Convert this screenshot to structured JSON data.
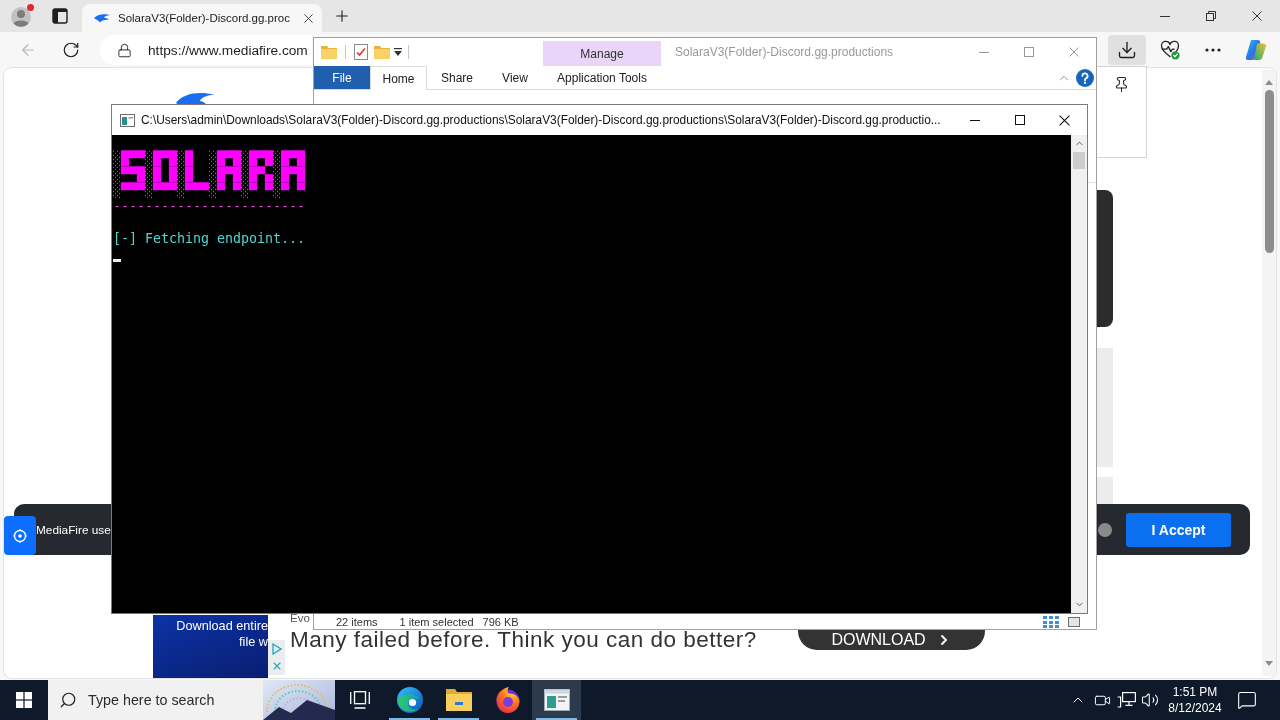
{
  "browser": {
    "tabs": [
      {
        "title": "SolaraV3(Folder)-Discord.gg.proc",
        "selected": true
      }
    ],
    "back_button": {
      "disabled": true
    },
    "address_bar": {
      "url": "https://www.mediafire.com"
    },
    "toolbar": [
      {
        "kind": "downloads",
        "selected": true
      },
      {
        "kind": "health",
        "selected": false
      },
      {
        "kind": "more",
        "selected": false
      },
      {
        "kind": "assistant",
        "selected": false
      }
    ]
  },
  "page": {
    "cookie_banner": {
      "text": "MediaFire use",
      "button": "I Accept"
    },
    "ad": {
      "image_lines": [
        "Download entire",
        "file w"
      ],
      "brand": "Evo",
      "headline": "Many failed before. Think you can do better?",
      "button": "DOWNLOAD"
    }
  },
  "explorer": {
    "title": "SolaraV3(Folder)-Discord.gg.productions",
    "context_label": "Manage",
    "ribbon_tabs": [
      {
        "label": "File",
        "kind": "file",
        "selected": false
      },
      {
        "label": "Home",
        "kind": "tab",
        "selected": true
      },
      {
        "label": "Share",
        "kind": "tab",
        "selected": false
      },
      {
        "label": "View",
        "kind": "tab",
        "selected": false
      },
      {
        "label": "Application Tools",
        "kind": "context",
        "selected": false
      }
    ],
    "status_bar": [
      "22 items",
      "1 item selected",
      "796 KB"
    ]
  },
  "console": {
    "title": "C:\\Users\\admin\\Downloads\\SolaraV3(Folder)-Discord.gg.productions\\SolaraV3(Folder)-Discord.gg.productions\\SolaraV3(Folder)-Discord.gg.productio...",
    "lines": [
      {
        "kind": "art",
        "text": "░█▀▀░█▀█░█  ░█▀█░█▀█░█▀█"
      },
      {
        "kind": "art",
        "text": "░▀▀█░█ █░█  ░█▀█░█▀▄░█▀█"
      },
      {
        "kind": "art",
        "text": "░▀▀▀░▀▀▀░▀▀▀░▀ ▀░▀ ▀░▀ ▀"
      },
      {
        "kind": "rule",
        "text": "------------------------"
      },
      {
        "kind": "status",
        "text": "[-] Fetching endpoint..."
      }
    ],
    "cursor_visible": true
  },
  "taskbar": {
    "search": {
      "placeholder": "Type here to search"
    },
    "apps": [
      {
        "kind": "edge",
        "running": true,
        "active": false
      },
      {
        "kind": "files",
        "running": true,
        "active": false
      },
      {
        "kind": "firefox",
        "running": false,
        "active": false
      },
      {
        "kind": "terminal",
        "running": true,
        "active": true
      }
    ],
    "clock": {
      "time": "1:51 PM",
      "date": "8/12/2024"
    }
  }
}
